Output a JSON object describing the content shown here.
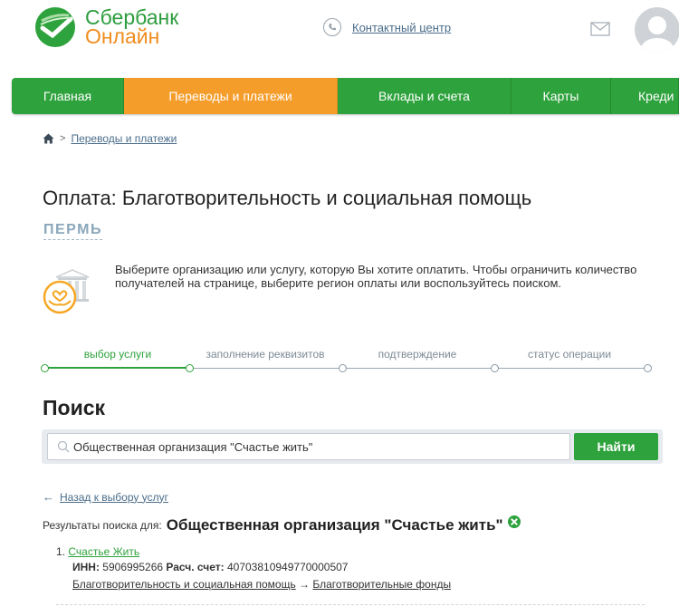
{
  "header": {
    "logo_line1": "Сбербанк",
    "logo_line2": "Онлайн",
    "contact_label": "Контактный центр"
  },
  "nav": {
    "items": [
      {
        "label": "Главная",
        "active": false
      },
      {
        "label": "Переводы и платежи",
        "active": true
      },
      {
        "label": "Вклады и счета",
        "active": false
      },
      {
        "label": "Карты",
        "active": false
      },
      {
        "label": "Креди",
        "active": false
      }
    ]
  },
  "breadcrumb": {
    "separator": ">",
    "link": "Переводы и платежи"
  },
  "page": {
    "title": "Оплата: Благотворительность и социальная помощь",
    "region": "ПЕРМЬ",
    "intro": "Выберите организацию или услугу, которую Вы хотите оплатить. Чтобы ограничить количество получателей на странице, выберите регион оплаты или воспользуйтесь поиском."
  },
  "steps": [
    {
      "label": "выбор услуги",
      "active": true
    },
    {
      "label": "заполнение реквизитов",
      "active": false
    },
    {
      "label": "подтверждение",
      "active": false
    },
    {
      "label": "статус операции",
      "active": false
    }
  ],
  "search": {
    "title": "Поиск",
    "value": "Общественная организация \"Счастье жить\"",
    "button_label": "Найти"
  },
  "results": {
    "back_label": "Назад к выбору услуг",
    "back_arrow": "←",
    "label": "Результаты поиска для:",
    "query": "Общественная организация \"Счастье жить\"",
    "items": [
      {
        "number": "1.",
        "name": "Счастье Жить",
        "inn_label": "ИНН:",
        "inn": "5906995266",
        "account_label": "Расч. счет:",
        "account": "40703810949770000507",
        "category": "Благотворительность и социальная помощь",
        "path_arrow": "→",
        "subcategory": "Благотворительные фонды"
      }
    ]
  },
  "colors": {
    "brand_green": "#2ea23c",
    "brand_orange": "#f59d2b",
    "link_blue": "#4a6d8a"
  },
  "icons": {
    "home": "home-icon",
    "contact": "phone-circle-icon",
    "mail": "mail-icon",
    "search": "search-icon",
    "clear": "clear-icon",
    "charity": "charity-hands-icon"
  }
}
